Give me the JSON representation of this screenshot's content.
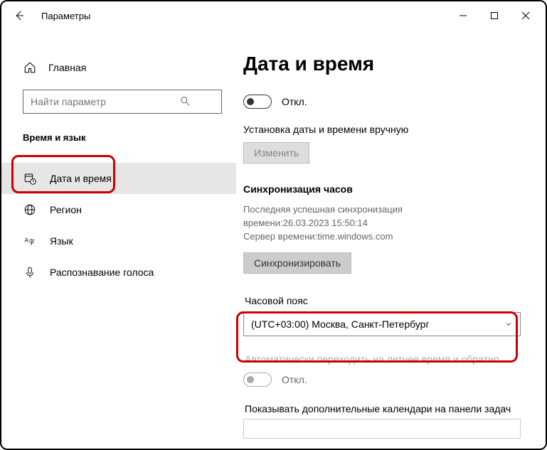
{
  "window": {
    "title": "Параметры"
  },
  "sidebar": {
    "home": "Главная",
    "search_placeholder": "Найти параметр",
    "category": "Время и язык",
    "items": [
      {
        "label": "Дата и время"
      },
      {
        "label": "Регион"
      },
      {
        "label": "Язык"
      },
      {
        "label": "Распознавание голоса"
      }
    ]
  },
  "main": {
    "heading": "Дата и время",
    "auto_time_off": "Откл.",
    "manual_label": "Установка даты и времени вручную",
    "change_btn": "Изменить",
    "sync_heading": "Синхронизация часов",
    "sync_last_line1": "Последняя успешная синхронизация",
    "sync_last_line2": "времени:26.03.2023 15:50:14",
    "sync_server": "Сервер времени:time.windows.com",
    "sync_btn": "Синхронизировать",
    "tz_heading": "Часовой пояс",
    "tz_value": "(UTC+03:00) Москва, Санкт-Петербург",
    "dst_label": "Автоматически переходить на летнее время и обратно",
    "dst_off": "Откл.",
    "extra_cal_heading": "Показывать дополнительные календари на панели задач"
  }
}
